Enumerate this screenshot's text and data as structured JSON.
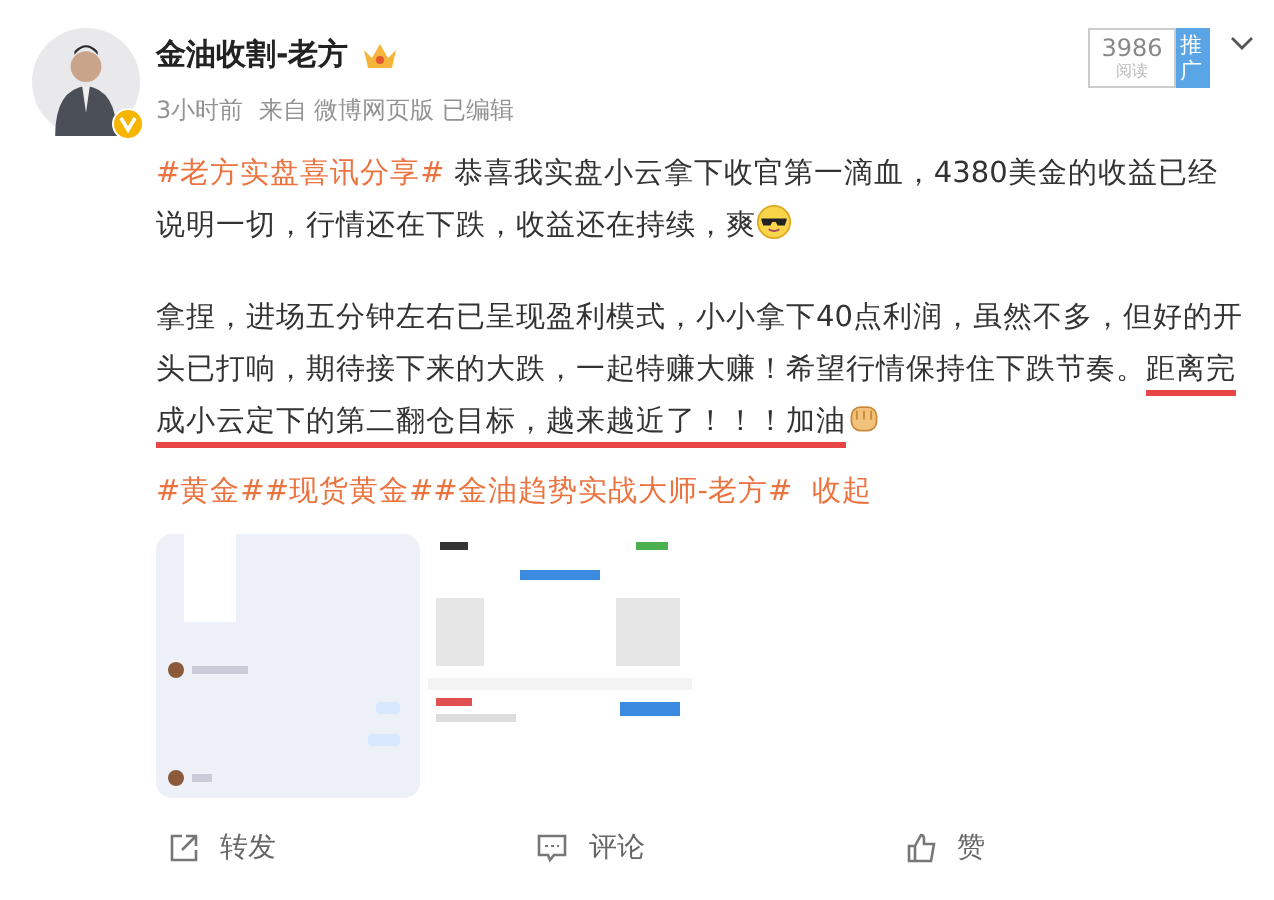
{
  "author": {
    "name": "金油收割-老方",
    "verified": true,
    "meta": "3小时前  来自 微博网页版 已编辑"
  },
  "promo": {
    "count": "3986",
    "count_label": "阅读",
    "tag": "推广"
  },
  "paragraphs": [
    {
      "segments": [
        {
          "text": "#老方实盘喜讯分享#",
          "kind": "topic"
        },
        {
          "text": " 恭喜我实盘小云拿下收官第一滴血，4380美金的收益已经说明一切，行情还在下跌，收益还在持续，爽",
          "kind": "plain"
        },
        {
          "kind": "sunglasses-emoji"
        }
      ]
    },
    {
      "segments": [
        {
          "text": "拿捏，进场五分钟左右已呈现盈利模式，小小拿下40点利润，虽然不多，但好的开头已打响，期待接下来的大跌，一起特赚大赚！希望行情保持住下跌节奏。",
          "kind": "plain"
        },
        {
          "text": "距离完成小云定下的第二翻仓目标，越来越近了！！！加油",
          "kind": "underlined"
        },
        {
          "kind": "fist-emoji"
        }
      ]
    }
  ],
  "tags": [
    {
      "text": "#黄金#"
    },
    {
      "text": "#现货黄金#"
    },
    {
      "text": "#金油趋势实战大师-老方#"
    }
  ],
  "collapse_link": "收起",
  "actions": [
    {
      "label": "转发",
      "kind": "share"
    },
    {
      "label": "评论",
      "kind": "comment"
    },
    {
      "label": "赞",
      "kind": "like"
    }
  ]
}
